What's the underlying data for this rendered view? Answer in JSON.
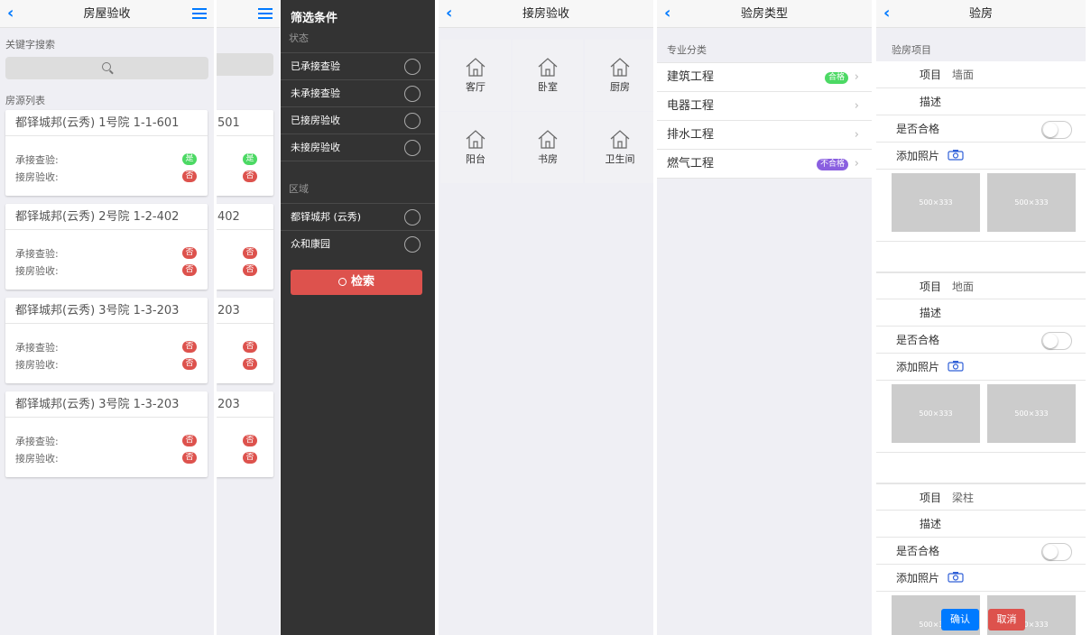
{
  "p1": {
    "title": "房屋验收",
    "keyword_label": "关键字搜索",
    "list_label": "房源列表",
    "field1": "承接查验:",
    "field2": "接房验收:",
    "cards": [
      {
        "name": "都铎城邦(云秀) 1号院 1-1-601",
        "b1": "是",
        "b2": "否",
        "b1c": "#4cd964"
      },
      {
        "name": "都铎城邦(云秀) 2号院 1-2-402",
        "b1": "否",
        "b2": "否",
        "b1c": "#dd524d"
      },
      {
        "name": "都铎城邦(云秀) 3号院 1-3-203",
        "b1": "否",
        "b2": "否",
        "b1c": "#dd524d"
      },
      {
        "name": "都铎城邦(云秀) 3号院 1-3-203",
        "b1": "否",
        "b2": "否",
        "b1c": "#dd524d"
      }
    ]
  },
  "p2": {
    "cards": [
      "501",
      "402",
      "203",
      "203"
    ],
    "b1": [
      "是",
      "否",
      "否",
      "否"
    ],
    "b2": [
      "否",
      "否",
      "否",
      "否"
    ]
  },
  "filter": {
    "title": "筛选条件",
    "status_label": "状态",
    "status": [
      "已承接查验",
      "未承接查验",
      "已接房验收",
      "未接房验收"
    ],
    "area_label": "区域",
    "areas": [
      "都铎城邦 (云秀)",
      "众和康园"
    ],
    "search": "检索"
  },
  "rooms": {
    "title": "接房验收",
    "items": [
      "客厅",
      "卧室",
      "厨房",
      "阳台",
      "书房",
      "卫生间"
    ]
  },
  "types": {
    "title": "验房类型",
    "section": "专业分类",
    "items": [
      {
        "name": "建筑工程",
        "tag": "合格",
        "tag_color": "#4cd964"
      },
      {
        "name": "电器工程",
        "tag": ""
      },
      {
        "name": "排水工程",
        "tag": ""
      },
      {
        "name": "燃气工程",
        "tag": "不合格",
        "tag_color": "#8a5fe0"
      }
    ]
  },
  "inspect": {
    "title": "验房",
    "section": "验房项目",
    "item_label": "项目",
    "desc_label": "描述",
    "pass_label": "是否合格",
    "photo_label": "添加照片",
    "placeholder": "500×333",
    "items": [
      "墙面",
      "地面",
      "梁柱"
    ],
    "confirm": "确认",
    "cancel": "取消"
  }
}
